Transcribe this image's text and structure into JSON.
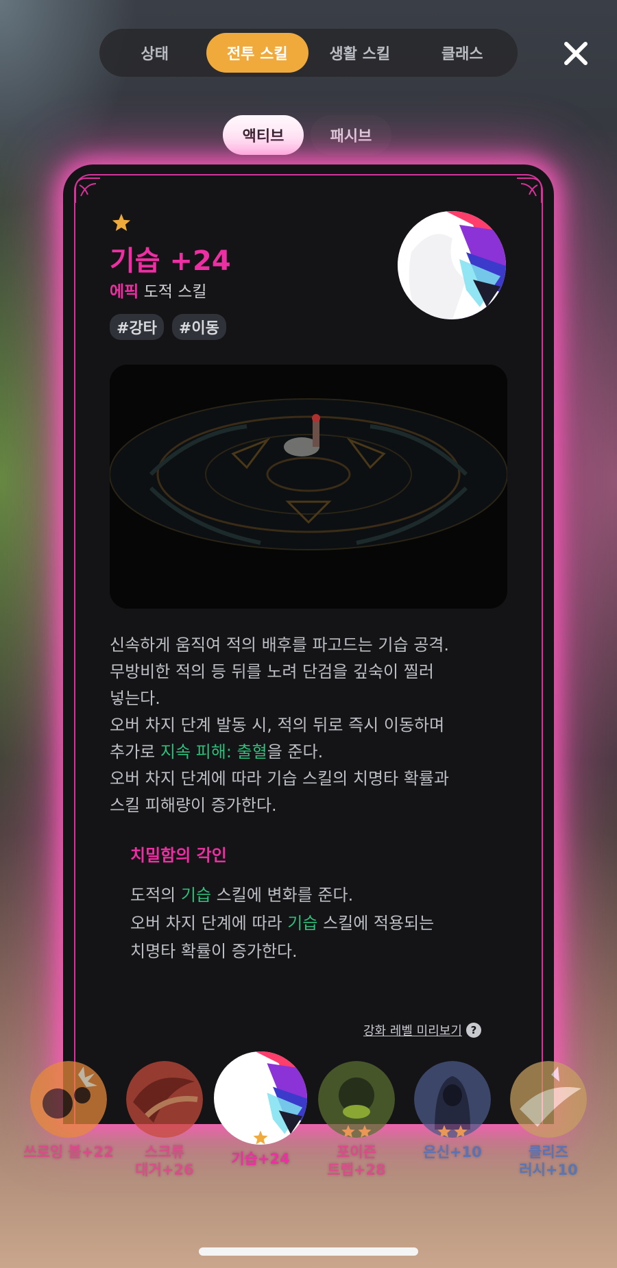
{
  "nav": {
    "tabs": [
      {
        "label": "상태"
      },
      {
        "label": "전투 스킬"
      },
      {
        "label": "생활 스킬"
      },
      {
        "label": "클래스"
      }
    ],
    "close_icon": "close-icon"
  },
  "sub_tabs": [
    {
      "label": "액티브"
    },
    {
      "label": "패시브"
    }
  ],
  "skill": {
    "star_count": 1,
    "title": "기습 +24",
    "rarity": "에픽",
    "class_type": "도적 스킬",
    "tags": [
      "#강타",
      "#이동"
    ],
    "description": {
      "p1": "신속하게 움직여 적의 배후를 파고드는 기습 공격.\n무방비한 적의 등 뒤를 노려 단검을 깊숙이 찔러\n넣는다.\n오버 차지 단계 발동 시, 적의 뒤로 즉시 이동하며\n추가로 ",
      "p1_highlight": "지속 피해: 출혈",
      "p1_tail": "을 준다.\n오버 차지 단계에 따라 기습 스킬의 치명타 확률과\n스킬 피해량이 증가한다."
    },
    "engraving": {
      "title": "치밀함의 각인",
      "l1_a": "도적의 ",
      "l1_hl": "기습",
      "l1_b": " 스킬에 변화를 준다.",
      "l2_a": "오버 차지 단계에 따라 ",
      "l2_hl": "기습",
      "l2_b": " 스킬에 적용되는",
      "l3": "치명타 확률이 증가한다."
    },
    "preview_link": "강화 레벨 미리보기",
    "help_icon_text": "?"
  },
  "skill_bar": [
    {
      "label": "쓰로잉 볼+22",
      "stars": 0
    },
    {
      "label": "스크류\n대거+26",
      "stars": 0
    },
    {
      "label": "기습+24",
      "stars": 1
    },
    {
      "label": "포이즌\n트랩+28",
      "stars": 2
    },
    {
      "label": "은신+10",
      "stars": 2
    },
    {
      "label": "클리즈\n러시+10",
      "stars": 0
    }
  ],
  "colors": {
    "accent_orange": "#f0a93b",
    "epic_pink": "#ee2fa4",
    "highlight_green": "#2fbf7b",
    "card_bg": "#141416"
  }
}
